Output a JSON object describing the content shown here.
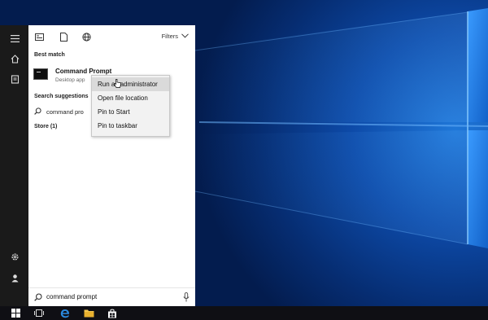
{
  "rail": {
    "icons": [
      "hamburger-menu-icon",
      "home-icon",
      "documents-icon",
      "settings-icon",
      "user-icon"
    ]
  },
  "panel": {
    "toolbar_icons": [
      "apps-icon",
      "documents-filter-icon",
      "web-icon"
    ],
    "filters_label": "Filters",
    "best_match_header": "Best match",
    "best_match": {
      "title": "Command Prompt",
      "subtitle": "Desktop app"
    },
    "suggestions_header": "Search suggestions",
    "suggestion": "command pro",
    "store_header": "Store (1)",
    "search": {
      "value": "command prompt"
    }
  },
  "context_menu": {
    "items": [
      {
        "label": "Run as administrator",
        "highlighted": true
      },
      {
        "label": "Open file location",
        "highlighted": false
      },
      {
        "label": "Pin to Start",
        "highlighted": false
      },
      {
        "label": "Pin to taskbar",
        "highlighted": false
      }
    ]
  },
  "taskbar": {
    "icons": [
      "windows-start-icon",
      "task-view-icon",
      "edge-icon",
      "file-explorer-icon",
      "store-icon"
    ]
  },
  "colors": {
    "accent": "#0078d7",
    "rail_bg": "#1a1a1a",
    "panel_bg": "#ffffff",
    "menu_bg": "#f2f2f2",
    "menu_highlight": "#dadada",
    "taskbar_bg": "#0f0f14"
  }
}
